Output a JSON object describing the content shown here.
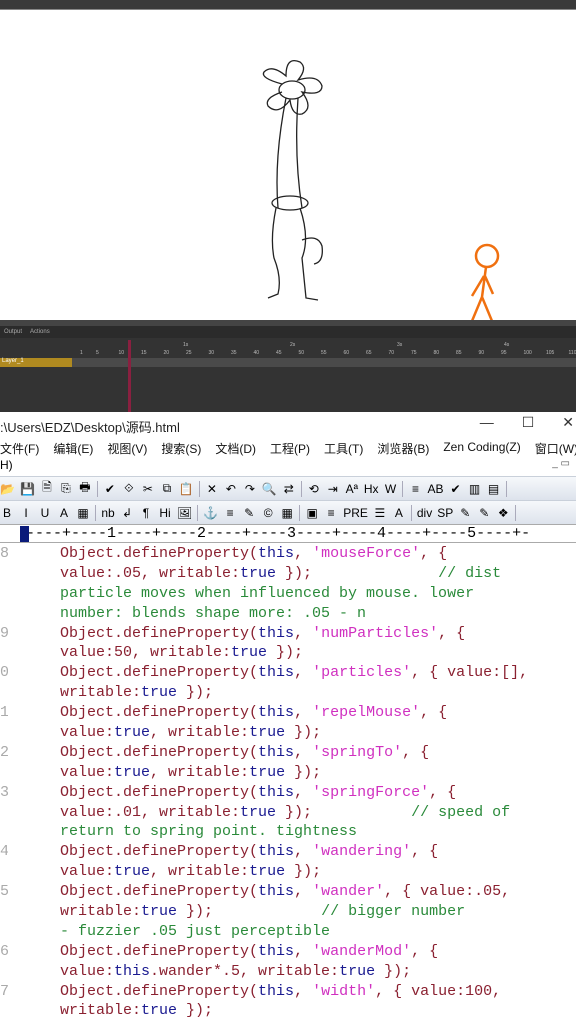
{
  "timeline": {
    "tabs": [
      "Output",
      "Actions"
    ],
    "seconds": [
      "1s",
      "2s",
      "3s",
      "4s"
    ],
    "frames": [
      "1",
      "5",
      "10",
      "15",
      "20",
      "25",
      "30",
      "35",
      "40",
      "45",
      "50",
      "55",
      "60",
      "65",
      "70",
      "75",
      "80",
      "85",
      "90",
      "95",
      "100",
      "105",
      "110"
    ],
    "layer_name": "Layer_1"
  },
  "editor": {
    "title": ":\\Users\\EDZ\\Desktop\\源码.html",
    "window_buttons": {
      "minimize": "—",
      "maximize": "☐",
      "close": "✕"
    },
    "menu": [
      "文件(F)",
      "编辑(E)",
      "视图(V)",
      "搜索(S)",
      "文档(D)",
      "工程(P)",
      "工具(T)",
      "浏览器(B)",
      "Zen Coding(Z)",
      "窗口(W)"
    ],
    "menu_overflow": "H)",
    "toolbar1": [
      "📂",
      "💾",
      "🗎",
      "⎘",
      "🖶",
      "✔",
      "⟐",
      "✂",
      "⧉",
      "📋",
      "✕",
      "↶",
      "↷",
      "🔍",
      "⇄",
      "⟲",
      "⇥",
      "Aª",
      "Hx",
      "W",
      "≡",
      "AB",
      "✔",
      "▥",
      "▤"
    ],
    "toolbar2": [
      "B",
      "I",
      "U",
      "A",
      "▦",
      "nb",
      "↲",
      "¶",
      "Hi",
      "🖼",
      "⚓",
      "≡",
      "✎",
      "©",
      "▦",
      "▣",
      "≡",
      "PRE",
      "☰",
      "A",
      "div",
      "SP",
      "✎",
      "✎",
      "❖"
    ],
    "ruler": "----+----1----+----2----+----3----+----4----+----5----+-",
    "code_lines": [
      {
        "num": "8",
        "rows": [
          [
            [
              "d",
              "Object.defineProperty("
            ],
            [
              "kw",
              "this"
            ],
            [
              "d",
              ", "
            ],
            [
              "str",
              "'mouseForce'"
            ],
            [
              "d",
              ", {"
            ]
          ],
          [
            [
              "d",
              "value:.05, writable:"
            ],
            [
              "kw",
              "true"
            ],
            [
              "d",
              " });              "
            ],
            [
              "cm",
              "// dist"
            ]
          ],
          [
            [
              "cm",
              "particle moves when influenced by mouse. lower"
            ]
          ],
          [
            [
              "cm",
              "number: blends shape more: .05 - n"
            ]
          ]
        ]
      },
      {
        "num": "9",
        "rows": [
          [
            [
              "d",
              "Object.defineProperty("
            ],
            [
              "kw",
              "this"
            ],
            [
              "d",
              ", "
            ],
            [
              "str",
              "'numParticles'"
            ],
            [
              "d",
              ", {"
            ]
          ],
          [
            [
              "d",
              "value:50, writable:"
            ],
            [
              "kw",
              "true"
            ],
            [
              "d",
              " });"
            ]
          ]
        ]
      },
      {
        "num": "0",
        "rows": [
          [
            [
              "d",
              "Object.defineProperty("
            ],
            [
              "kw",
              "this"
            ],
            [
              "d",
              ", "
            ],
            [
              "str",
              "'particles'"
            ],
            [
              "d",
              ", { value:[],"
            ]
          ],
          [
            [
              "d",
              "writable:"
            ],
            [
              "kw",
              "true"
            ],
            [
              "d",
              " });"
            ]
          ]
        ]
      },
      {
        "num": "1",
        "rows": [
          [
            [
              "d",
              "Object.defineProperty("
            ],
            [
              "kw",
              "this"
            ],
            [
              "d",
              ", "
            ],
            [
              "str",
              "'repelMouse'"
            ],
            [
              "d",
              ", {"
            ]
          ],
          [
            [
              "d",
              "value:"
            ],
            [
              "kw",
              "true"
            ],
            [
              "d",
              ", writable:"
            ],
            [
              "kw",
              "true"
            ],
            [
              "d",
              " });"
            ]
          ]
        ]
      },
      {
        "num": "2",
        "rows": [
          [
            [
              "d",
              "Object.defineProperty("
            ],
            [
              "kw",
              "this"
            ],
            [
              "d",
              ", "
            ],
            [
              "str",
              "'springTo'"
            ],
            [
              "d",
              ", {"
            ]
          ],
          [
            [
              "d",
              "value:"
            ],
            [
              "kw",
              "true"
            ],
            [
              "d",
              ", writable:"
            ],
            [
              "kw",
              "true"
            ],
            [
              "d",
              " });"
            ]
          ]
        ]
      },
      {
        "num": "3",
        "rows": [
          [
            [
              "d",
              "Object.defineProperty("
            ],
            [
              "kw",
              "this"
            ],
            [
              "d",
              ", "
            ],
            [
              "str",
              "'springForce'"
            ],
            [
              "d",
              ", {"
            ]
          ],
          [
            [
              "d",
              "value:.01, writable:"
            ],
            [
              "kw",
              "true"
            ],
            [
              "d",
              " });           "
            ],
            [
              "cm",
              "// speed of"
            ]
          ],
          [
            [
              "cm",
              "return to spring point. tightness"
            ]
          ]
        ]
      },
      {
        "num": "4",
        "rows": [
          [
            [
              "d",
              "Object.defineProperty("
            ],
            [
              "kw",
              "this"
            ],
            [
              "d",
              ", "
            ],
            [
              "str",
              "'wandering'"
            ],
            [
              "d",
              ", {"
            ]
          ],
          [
            [
              "d",
              "value:"
            ],
            [
              "kw",
              "true"
            ],
            [
              "d",
              ", writable:"
            ],
            [
              "kw",
              "true"
            ],
            [
              "d",
              " });"
            ]
          ]
        ]
      },
      {
        "num": "5",
        "rows": [
          [
            [
              "d",
              "Object.defineProperty("
            ],
            [
              "kw",
              "this"
            ],
            [
              "d",
              ", "
            ],
            [
              "str",
              "'wander'"
            ],
            [
              "d",
              ", { value:.05,"
            ]
          ],
          [
            [
              "d",
              "writable:"
            ],
            [
              "kw",
              "true"
            ],
            [
              "d",
              " });            "
            ],
            [
              "cm",
              "// bigger number"
            ]
          ],
          [
            [
              "cm",
              "- fuzzier .05 just perceptible"
            ]
          ]
        ]
      },
      {
        "num": "6",
        "rows": [
          [
            [
              "d",
              "Object.defineProperty("
            ],
            [
              "kw",
              "this"
            ],
            [
              "d",
              ", "
            ],
            [
              "str",
              "'wanderMod'"
            ],
            [
              "d",
              ", {"
            ]
          ],
          [
            [
              "d",
              "value:"
            ],
            [
              "kw",
              "this"
            ],
            [
              "d",
              ".wander*.5, writable:"
            ],
            [
              "kw",
              "true"
            ],
            [
              "d",
              " });"
            ]
          ]
        ]
      },
      {
        "num": "7",
        "rows": [
          [
            [
              "d",
              "Object.defineProperty("
            ],
            [
              "kw",
              "this"
            ],
            [
              "d",
              ", "
            ],
            [
              "str",
              "'width'"
            ],
            [
              "d",
              ", { value:100,"
            ]
          ],
          [
            [
              "d",
              "writable:"
            ],
            [
              "kw",
              "true"
            ],
            [
              "d",
              " });"
            ]
          ]
        ]
      }
    ]
  },
  "colors": {
    "stick_figure": "#f07010",
    "default_code": "#8a2030",
    "keyword": "#1a1a90",
    "string": "#d030c0",
    "comment": "#2a8a3a",
    "layer": "#b08a20"
  }
}
